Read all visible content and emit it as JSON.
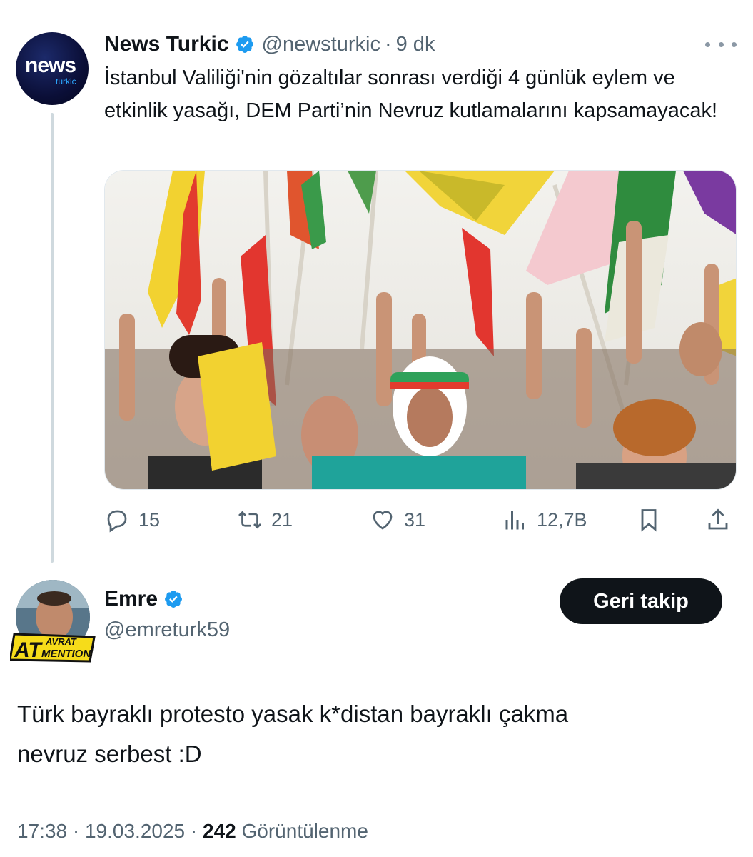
{
  "parent": {
    "display_name": "News Turkic",
    "handle": "@newsturkic",
    "separator": "·",
    "time": "9 dk",
    "avatar_word": "news",
    "avatar_sub": "turkic",
    "text": "İstanbul Valiliği'nin gözaltılar sonrası verdiği 4 günlük eylem ve etkinlik yasağı, DEM Parti’nin Nevruz kutlamalarını kapsamayacak!",
    "metrics": {
      "replies": "15",
      "reposts": "21",
      "likes": "31",
      "views": "12,7B"
    },
    "icons": {
      "verified": "verified-badge-icon",
      "more": "more-dots-icon",
      "reply": "reply-icon",
      "repost": "repost-icon",
      "like": "heart-icon",
      "views": "views-chart-icon",
      "bookmark": "bookmark-icon",
      "share": "share-icon"
    }
  },
  "reply": {
    "display_name": "Emre",
    "handle": "@emreturk59",
    "follow_button": "Geri takip",
    "badge_main": "AT",
    "badge_top": "AVRAT",
    "badge_bottom": "MENTION",
    "text_line1": "Türk bayraklı protesto yasak k*distan bayraklı çakma",
    "text_line2": "nevruz serbest :D",
    "time": "17:38",
    "date": "19.03.2025",
    "views_count": "242",
    "views_label": "Görüntülenme",
    "separator": "·"
  },
  "colors": {
    "verified_blue": "#1d9bf0",
    "text_primary": "#0f1419",
    "text_secondary": "#536471",
    "thread_line": "#cfd9de",
    "button_bg": "#0f1419"
  }
}
